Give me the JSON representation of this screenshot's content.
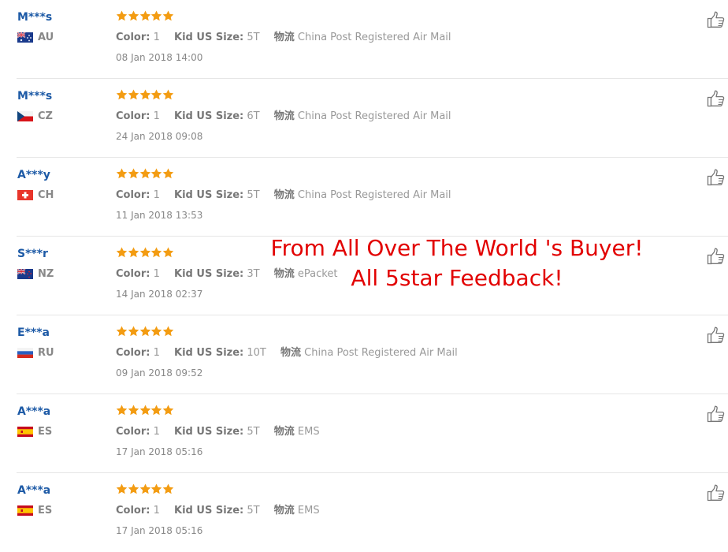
{
  "feedback": [
    {
      "user": "M***s",
      "country": "AU",
      "flag": "au-flag-icon",
      "color_label": "Color:",
      "color": "1",
      "size_label": "Kid US Size:",
      "size": "5T",
      "ship_label": "物流",
      "shipping": "China Post Registered Air Mail",
      "date": "08 Jan 2018 14:00"
    },
    {
      "user": "M***s",
      "country": "CZ",
      "flag": "cz-flag-icon",
      "color_label": "Color:",
      "color": "1",
      "size_label": "Kid US Size:",
      "size": "6T",
      "ship_label": "物流",
      "shipping": "China Post Registered Air Mail",
      "date": "24 Jan 2018 09:08"
    },
    {
      "user": "A***y",
      "country": "CH",
      "flag": "ch-flag-icon",
      "color_label": "Color:",
      "color": "1",
      "size_label": "Kid US Size:",
      "size": "5T",
      "ship_label": "物流",
      "shipping": "China Post Registered Air Mail",
      "date": "11 Jan 2018 13:53"
    },
    {
      "user": "S***r",
      "country": "NZ",
      "flag": "nz-flag-icon",
      "color_label": "Color:",
      "color": "1",
      "size_label": "Kid US Size:",
      "size": "3T",
      "ship_label": "物流",
      "shipping": "ePacket",
      "date": "14 Jan 2018 02:37"
    },
    {
      "user": "E***a",
      "country": "RU",
      "flag": "ru-flag-icon",
      "color_label": "Color:",
      "color": "1",
      "size_label": "Kid US Size:",
      "size": "10T",
      "ship_label": "物流",
      "shipping": "China Post Registered Air Mail",
      "date": "09 Jan 2018 09:52"
    },
    {
      "user": "A***a",
      "country": "ES",
      "flag": "es-flag-icon",
      "color_label": "Color:",
      "color": "1",
      "size_label": "Kid US Size:",
      "size": "5T",
      "ship_label": "物流",
      "shipping": "EMS",
      "date": "17 Jan 2018 05:16"
    },
    {
      "user": "A***a",
      "country": "ES",
      "flag": "es-flag-icon",
      "color_label": "Color:",
      "color": "1",
      "size_label": "Kid US Size:",
      "size": "5T",
      "ship_label": "物流",
      "shipping": "EMS",
      "date": "17 Jan 2018 05:16"
    }
  ],
  "rating_stars": 5,
  "overlay": {
    "line1": "From All Over The World 's Buyer!",
    "line2": "All 5star Feedback!"
  },
  "colors": {
    "user_name": "#1d5aa6",
    "star": "#f39c12",
    "overlay_text": "#e20000"
  }
}
